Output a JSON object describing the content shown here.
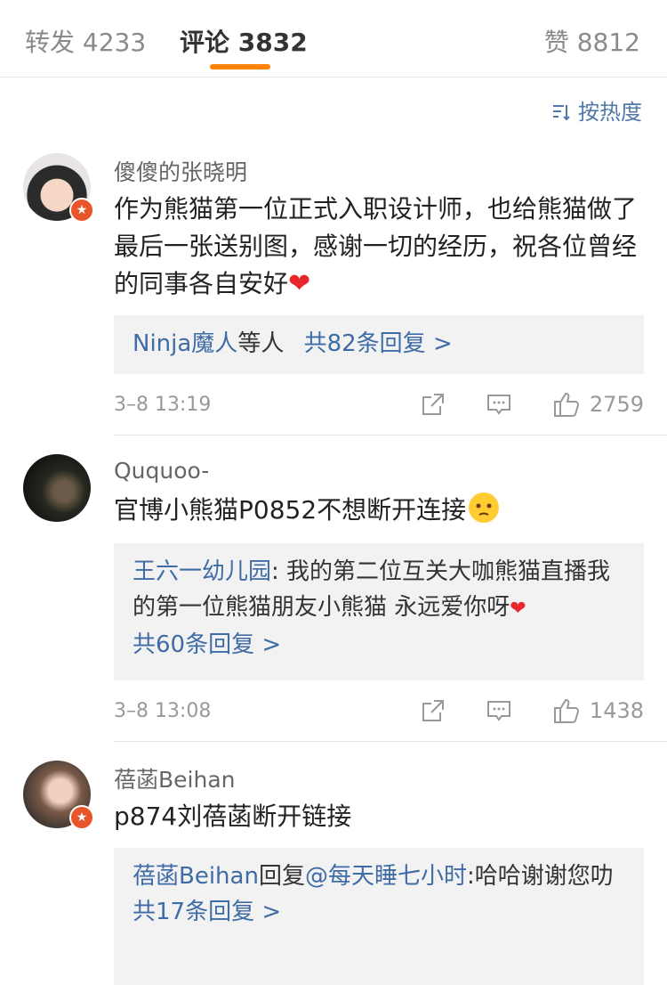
{
  "tabs": {
    "repost": "转发 4233",
    "comment": "评论 3832",
    "like": "赞 8812"
  },
  "sort_label": "按热度",
  "comments": [
    {
      "user": "傻傻的张晓明",
      "text": "作为熊猫第一位正式入职设计师，也给熊猫做了最后一张送别图，感谢一切的经历，祝各位曾经的同事各自安好",
      "reply_users": "Ninja魔人",
      "reply_users_suffix": "等人",
      "reply_count": "共82条回复 >",
      "time": "3–8 13:19",
      "likes": "2759"
    },
    {
      "user": "Ququoo-",
      "text": "官博小熊猫P0852不想断开连接",
      "reply_user": "王六一幼儿园",
      "reply_text": ": 我的第二位互关大咖熊猫直播我的第一位熊猫朋友小熊猫 永远爱你呀",
      "reply_count": "共60条回复 >",
      "time": "3–8 13:08",
      "likes": "1438"
    },
    {
      "user": "蓓菡Beihan",
      "text": "p874刘蓓菡断开链接",
      "reply_user": "蓓菡Beihan",
      "reply_mid": "回复",
      "reply_target": "@每天睡七小时",
      "reply_text": ":哈哈谢谢您叻",
      "reply_count": "共17条回复 >"
    }
  ],
  "colors": {
    "accent": "#ff8200",
    "link": "#3f6ba6",
    "badge": "#e8552b",
    "heart": "#e8262b"
  }
}
